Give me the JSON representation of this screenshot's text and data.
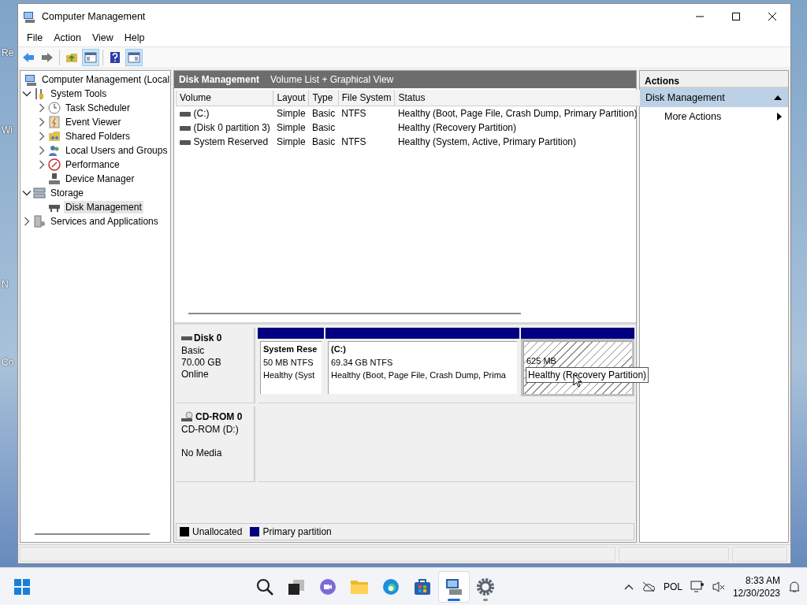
{
  "desktop_icons": [
    {
      "label": "Re"
    },
    {
      "label": "Wi"
    },
    {
      "label": "N"
    },
    {
      "label": "Co"
    }
  ],
  "window": {
    "title": "Computer Management"
  },
  "menu": [
    "File",
    "Action",
    "View",
    "Help"
  ],
  "toolbar": [
    {
      "kind": "back",
      "pressed": false
    },
    {
      "kind": "forward",
      "pressed": false
    },
    {
      "kind": "up",
      "pressed": false
    },
    {
      "kind": "tree",
      "pressed": true
    },
    {
      "kind": "help",
      "pressed": false
    },
    {
      "kind": "pane",
      "pressed": true
    }
  ],
  "tree": [
    {
      "label": "Computer Management (Local",
      "kind": "computer",
      "selected": false,
      "children": [
        {
          "label": "System Tools",
          "kind": "tools",
          "expanded": true,
          "selected": false,
          "children": [
            {
              "label": "Task Scheduler",
              "kind": "clock",
              "expanded": false,
              "selected": false
            },
            {
              "label": "Event Viewer",
              "kind": "log",
              "expanded": false,
              "selected": false
            },
            {
              "label": "Shared Folders",
              "kind": "folder",
              "expanded": false,
              "selected": false
            },
            {
              "label": "Local Users and Groups",
              "kind": "users",
              "expanded": false,
              "selected": false
            },
            {
              "label": "Performance",
              "kind": "gauge",
              "expanded": false,
              "selected": false
            },
            {
              "label": "Device Manager",
              "kind": "device",
              "selected": false
            }
          ]
        },
        {
          "label": "Storage",
          "kind": "storage",
          "expanded": true,
          "selected": false,
          "children": [
            {
              "label": "Disk Management",
              "kind": "disk",
              "selected": true
            }
          ]
        },
        {
          "label": "Services and Applications",
          "kind": "services",
          "expanded": false,
          "selected": false
        }
      ]
    }
  ],
  "panel_header": {
    "title": "Disk Management",
    "subtitle": "Volume List + Graphical View"
  },
  "volume_table": {
    "columns": [
      "Volume",
      "Layout",
      "Type",
      "File System",
      "Status"
    ],
    "rows": [
      [
        "(C:)",
        "Simple",
        "Basic",
        "NTFS",
        "Healthy (Boot, Page File, Crash Dump, Primary Partition)"
      ],
      [
        "(Disk 0 partition 3)",
        "Simple",
        "Basic",
        "",
        "Healthy (Recovery Partition)"
      ],
      [
        "System Reserved",
        "Simple",
        "Basic",
        "NTFS",
        "Healthy (System, Active, Primary Partition)"
      ]
    ]
  },
  "disks": [
    {
      "name": "Disk 0",
      "kind": "disk",
      "type": "Basic",
      "size": "70.00 GB",
      "status": "Online",
      "partitions": [
        {
          "title": "System Rese",
          "lines": [
            "50 MB NTFS",
            "Healthy (Syst"
          ],
          "selected": false
        },
        {
          "title": "(C:)",
          "lines": [
            "69.34 GB NTFS",
            "Healthy (Boot, Page File, Crash Dump, Prima"
          ],
          "selected": false
        },
        {
          "lines": [
            "625 MB"
          ],
          "selected": true,
          "tooltip": "Healthy (Recovery Partition)"
        }
      ]
    },
    {
      "name": "CD-ROM 0",
      "kind": "cdrom",
      "type": "CD-ROM (D:)",
      "status": "No Media"
    }
  ],
  "legend": [
    {
      "label": "Unallocated",
      "color": "#000000"
    },
    {
      "label": "Primary partition",
      "color": "#000080"
    }
  ],
  "actions": {
    "title": "Actions",
    "section": "Disk Management",
    "expanded": true,
    "items": [
      "More Actions"
    ]
  },
  "taskbar": {
    "apps": [
      {
        "kind": "start",
        "running": false,
        "selected": false
      },
      {
        "kind": "search",
        "running": false,
        "selected": false
      },
      {
        "kind": "taskview",
        "running": false,
        "selected": false
      },
      {
        "kind": "chat",
        "running": false,
        "selected": false
      },
      {
        "kind": "explorer",
        "running": false,
        "selected": false
      },
      {
        "kind": "edge",
        "running": false,
        "selected": false
      },
      {
        "kind": "store",
        "running": false,
        "selected": false
      },
      {
        "kind": "compmgmt",
        "running": true,
        "selected": true
      },
      {
        "kind": "settings",
        "running": true,
        "selected": false
      }
    ],
    "language": "POL",
    "time": "8:33 AM",
    "date": "12/30/2023"
  }
}
